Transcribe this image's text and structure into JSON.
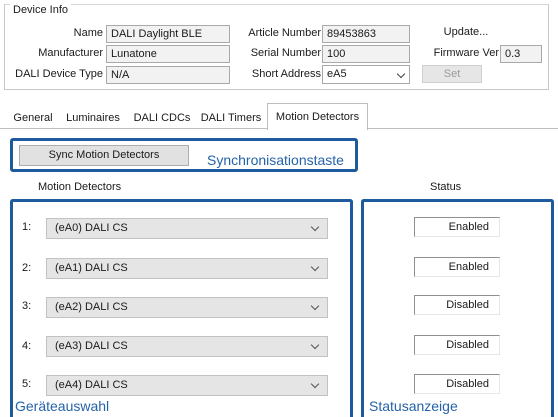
{
  "device_info": {
    "title": "Device Info",
    "name_label": "Name",
    "name_value": "DALI Daylight BLE",
    "manufacturer_label": "Manufacturer",
    "manufacturer_value": "Lunatone",
    "device_type_label": "DALI Device Type",
    "device_type_value": "N/A",
    "article_label": "Article Number",
    "article_value": "89453863",
    "serial_label": "Serial Number",
    "serial_value": "100",
    "short_address_label": "Short Address",
    "short_address_value": "eA5",
    "update_label": "Update...",
    "firmware_label": "Firmware Ver",
    "firmware_value": "0.3",
    "set_label": "Set"
  },
  "tabs": [
    {
      "label": "General",
      "active": false
    },
    {
      "label": "Luminaires",
      "active": false
    },
    {
      "label": "DALI CDCs",
      "active": false
    },
    {
      "label": "DALI Timers",
      "active": false
    },
    {
      "label": "Motion Detectors",
      "active": true
    }
  ],
  "panel": {
    "sync_button_label": "Sync Motion Detectors",
    "detectors_header": "Motion Detectors",
    "status_header": "Status",
    "rows": [
      {
        "index": "1:",
        "detector": "(eA0) DALI CS",
        "status": "Enabled"
      },
      {
        "index": "2:",
        "detector": "(eA1) DALI CS",
        "status": "Enabled"
      },
      {
        "index": "3:",
        "detector": "(eA2) DALI CS",
        "status": "Disabled"
      },
      {
        "index": "4:",
        "detector": "(eA3) DALI CS",
        "status": "Disabled"
      },
      {
        "index": "5:",
        "detector": "(eA4) DALI CS",
        "status": "Disabled"
      }
    ]
  },
  "annotations": {
    "sync_label": "Synchronisationstaste",
    "device_select_label": "Geräteauswahl",
    "status_label": "Statusanzeige",
    "highlight_color": "#1e5a9e"
  }
}
